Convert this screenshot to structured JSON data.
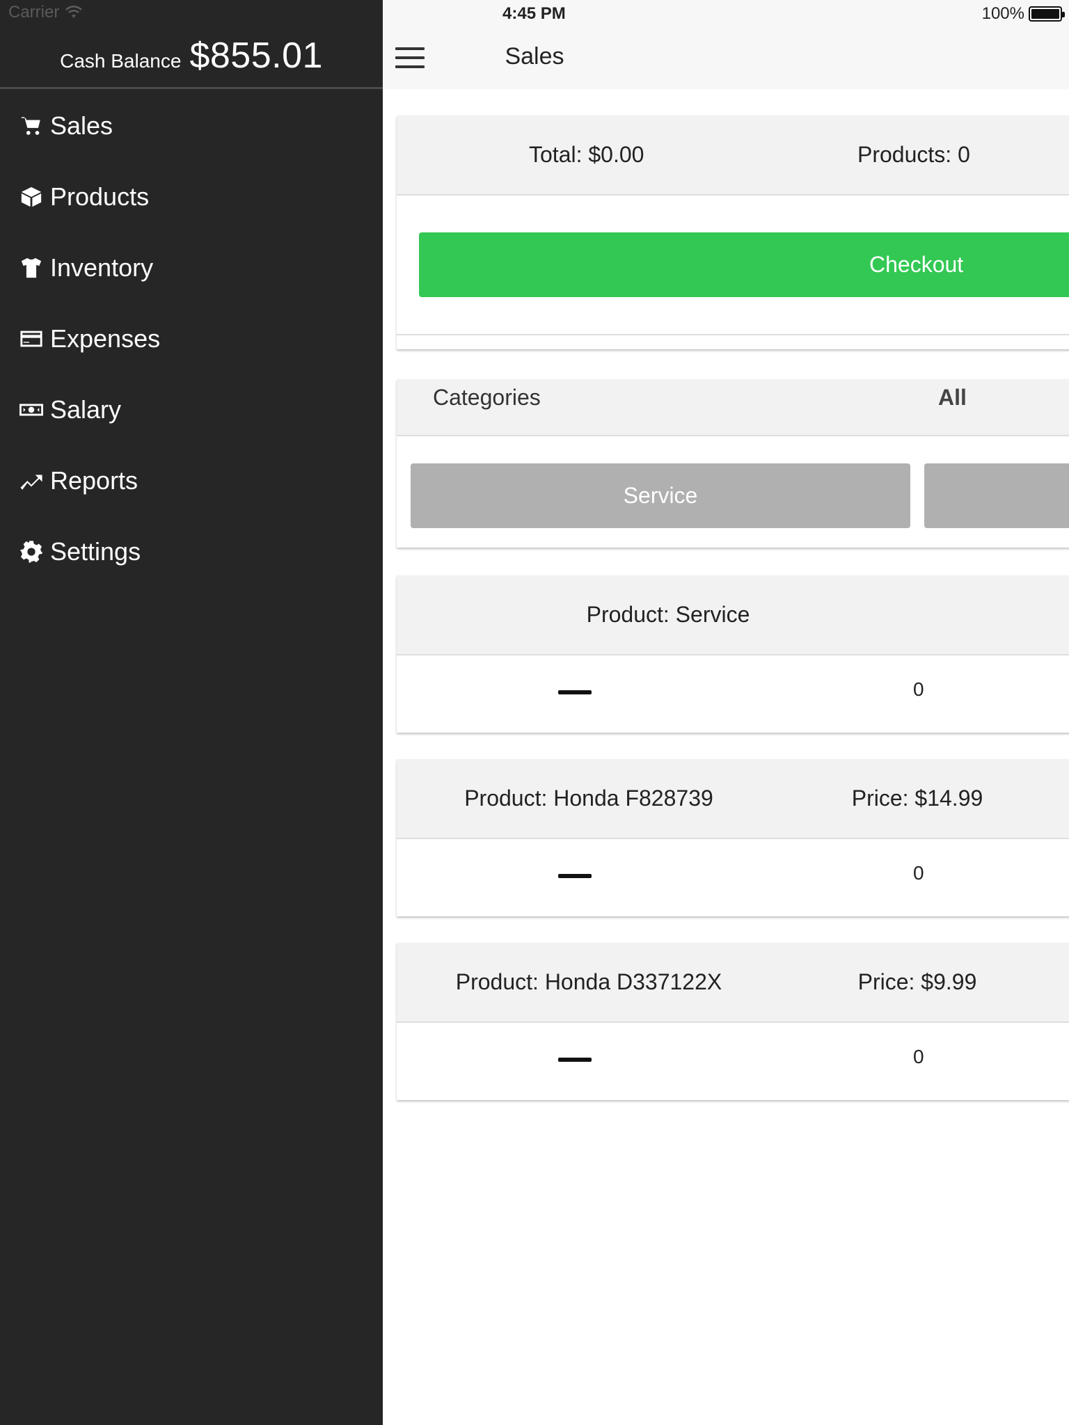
{
  "status": {
    "carrier": "Carrier",
    "time": "4:45 PM",
    "battery": "100%"
  },
  "drawer": {
    "cash_label": "Cash Balance",
    "cash_value": "$855.01",
    "items": [
      {
        "label": "Sales",
        "icon": "cart-icon"
      },
      {
        "label": "Products",
        "icon": "cube-icon"
      },
      {
        "label": "Inventory",
        "icon": "shirt-icon"
      },
      {
        "label": "Expenses",
        "icon": "credit-card-icon"
      },
      {
        "label": "Salary",
        "icon": "money-icon"
      },
      {
        "label": "Reports",
        "icon": "trend-icon"
      },
      {
        "label": "Settings",
        "icon": "gear-icon"
      }
    ]
  },
  "header": {
    "title": "Sales"
  },
  "summary": {
    "total": "Total: $0.00",
    "products": "Products: 0",
    "checkout_label": "Checkout"
  },
  "categories": {
    "label": "Categories",
    "selected": "All",
    "buttons": [
      "Service",
      ""
    ]
  },
  "products": [
    {
      "name": "Product: Service",
      "price": "",
      "quantity": "0"
    },
    {
      "name": "Product: Honda F828739",
      "price": "Price: $14.99",
      "quantity": "0"
    },
    {
      "name": "Product: Honda D337122X",
      "price": "Price: $9.99",
      "quantity": "0"
    }
  ],
  "colors": {
    "drawer_bg": "#262626",
    "checkout_green": "#33c854",
    "category_gray": "#b0b0b0"
  }
}
